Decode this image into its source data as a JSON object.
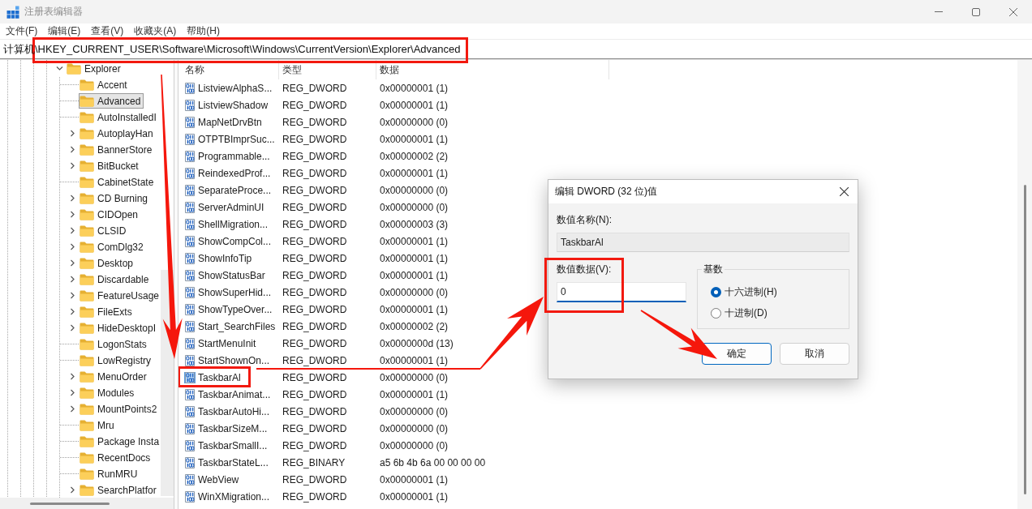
{
  "window": {
    "title": "注册表编辑器"
  },
  "menu": [
    "文件(F)",
    "编辑(E)",
    "查看(V)",
    "收藏夹(A)",
    "帮助(H)"
  ],
  "address_bar": {
    "path": "计算机\\HKEY_CURRENT_USER\\Software\\Microsoft\\Windows\\CurrentVersion\\Explorer\\Advanced",
    "highlighted": true
  },
  "tree": {
    "items": [
      {
        "label": "Explorer",
        "expandable": true,
        "expanded": true,
        "selected": false,
        "children": [
          {
            "label": "Accent",
            "expandable": false,
            "selected": false
          },
          {
            "label": "Advanced",
            "expandable": false,
            "selected": true
          },
          {
            "label": "AutoInstalledI",
            "expandable": false,
            "selected": false
          },
          {
            "label": "AutoplayHan",
            "expandable": true,
            "selected": false
          },
          {
            "label": "BannerStore",
            "expandable": true,
            "selected": false
          },
          {
            "label": "BitBucket",
            "expandable": true,
            "selected": false
          },
          {
            "label": "CabinetState",
            "expandable": false,
            "selected": false
          },
          {
            "label": "CD Burning",
            "expandable": true,
            "selected": false
          },
          {
            "label": "CIDOpen",
            "expandable": true,
            "selected": false
          },
          {
            "label": "CLSID",
            "expandable": true,
            "selected": false
          },
          {
            "label": "ComDlg32",
            "expandable": true,
            "selected": false
          },
          {
            "label": "Desktop",
            "expandable": true,
            "selected": false
          },
          {
            "label": "Discardable",
            "expandable": true,
            "selected": false
          },
          {
            "label": "FeatureUsage",
            "expandable": true,
            "selected": false
          },
          {
            "label": "FileExts",
            "expandable": true,
            "selected": false
          },
          {
            "label": "HideDesktopI",
            "expandable": true,
            "selected": false
          },
          {
            "label": "LogonStats",
            "expandable": false,
            "selected": false
          },
          {
            "label": "LowRegistry",
            "expandable": false,
            "selected": false
          },
          {
            "label": "MenuOrder",
            "expandable": true,
            "selected": false
          },
          {
            "label": "Modules",
            "expandable": true,
            "selected": false
          },
          {
            "label": "MountPoints2",
            "expandable": true,
            "selected": false
          },
          {
            "label": "Mru",
            "expandable": false,
            "selected": false
          },
          {
            "label": "Package Insta",
            "expandable": false,
            "selected": false
          },
          {
            "label": "RecentDocs",
            "expandable": false,
            "selected": false
          },
          {
            "label": "RunMRU",
            "expandable": false,
            "selected": false
          },
          {
            "label": "SearchPlatfor",
            "expandable": true,
            "selected": false
          }
        ]
      }
    ]
  },
  "values_table": {
    "columns": [
      "名称",
      "类型",
      "数据"
    ],
    "rows": [
      {
        "name": "ListviewAlphaS...",
        "type": "REG_DWORD",
        "data": "0x00000001 (1)",
        "selected": false,
        "highlighted": false
      },
      {
        "name": "ListviewShadow",
        "type": "REG_DWORD",
        "data": "0x00000001 (1)",
        "selected": false,
        "highlighted": false
      },
      {
        "name": "MapNetDrvBtn",
        "type": "REG_DWORD",
        "data": "0x00000000 (0)",
        "selected": false,
        "highlighted": false
      },
      {
        "name": "OTPTBImprSuc...",
        "type": "REG_DWORD",
        "data": "0x00000001 (1)",
        "selected": false,
        "highlighted": false
      },
      {
        "name": "Programmable...",
        "type": "REG_DWORD",
        "data": "0x00000002 (2)",
        "selected": false,
        "highlighted": false
      },
      {
        "name": "ReindexedProf...",
        "type": "REG_DWORD",
        "data": "0x00000001 (1)",
        "selected": false,
        "highlighted": false
      },
      {
        "name": "SeparateProce...",
        "type": "REG_DWORD",
        "data": "0x00000000 (0)",
        "selected": false,
        "highlighted": false
      },
      {
        "name": "ServerAdminUI",
        "type": "REG_DWORD",
        "data": "0x00000000 (0)",
        "selected": false,
        "highlighted": false
      },
      {
        "name": "ShellMigration...",
        "type": "REG_DWORD",
        "data": "0x00000003 (3)",
        "selected": false,
        "highlighted": false
      },
      {
        "name": "ShowCompCol...",
        "type": "REG_DWORD",
        "data": "0x00000001 (1)",
        "selected": false,
        "highlighted": false
      },
      {
        "name": "ShowInfoTip",
        "type": "REG_DWORD",
        "data": "0x00000001 (1)",
        "selected": false,
        "highlighted": false
      },
      {
        "name": "ShowStatusBar",
        "type": "REG_DWORD",
        "data": "0x00000001 (1)",
        "selected": false,
        "highlighted": false
      },
      {
        "name": "ShowSuperHid...",
        "type": "REG_DWORD",
        "data": "0x00000000 (0)",
        "selected": false,
        "highlighted": false
      },
      {
        "name": "ShowTypeOver...",
        "type": "REG_DWORD",
        "data": "0x00000001 (1)",
        "selected": false,
        "highlighted": false
      },
      {
        "name": "Start_SearchFiles",
        "type": "REG_DWORD",
        "data": "0x00000002 (2)",
        "selected": false,
        "highlighted": false
      },
      {
        "name": "StartMenuInit",
        "type": "REG_DWORD",
        "data": "0x0000000d (13)",
        "selected": false,
        "highlighted": false
      },
      {
        "name": "StartShownOn...",
        "type": "REG_DWORD",
        "data": "0x00000001 (1)",
        "selected": false,
        "highlighted": false
      },
      {
        "name": "TaskbarAl",
        "type": "REG_DWORD",
        "data": "0x00000000 (0)",
        "selected": true,
        "highlighted": true
      },
      {
        "name": "TaskbarAnimat...",
        "type": "REG_DWORD",
        "data": "0x00000001 (1)",
        "selected": false,
        "highlighted": false
      },
      {
        "name": "TaskbarAutoHi...",
        "type": "REG_DWORD",
        "data": "0x00000000 (0)",
        "selected": false,
        "highlighted": false
      },
      {
        "name": "TaskbarSizeM...",
        "type": "REG_DWORD",
        "data": "0x00000000 (0)",
        "selected": false,
        "highlighted": false
      },
      {
        "name": "TaskbarSmallI...",
        "type": "REG_DWORD",
        "data": "0x00000000 (0)",
        "selected": false,
        "highlighted": false
      },
      {
        "name": "TaskbarStateL...",
        "type": "REG_BINARY",
        "data": "a5 6b 4b 6a 00 00 00 00",
        "selected": false,
        "highlighted": false
      },
      {
        "name": "WebView",
        "type": "REG_DWORD",
        "data": "0x00000001 (1)",
        "selected": false,
        "highlighted": false
      },
      {
        "name": "WinXMigration...",
        "type": "REG_DWORD",
        "data": "0x00000001 (1)",
        "selected": false,
        "highlighted": false
      }
    ]
  },
  "dialog": {
    "title": "编辑 DWORD (32 位)值",
    "name_field": {
      "label": "数值名称(N):",
      "value": "TaskbarAl",
      "disabled": true
    },
    "data_field": {
      "label": "数值数据(V):",
      "value": "0",
      "highlighted": true
    },
    "base": {
      "title": "基数",
      "options": [
        {
          "label": "十六进制(H)",
          "selected": true
        },
        {
          "label": "十进制(D)",
          "selected": false
        }
      ]
    },
    "buttons": [
      {
        "label": "确定",
        "default": true
      },
      {
        "label": "取消",
        "default": false
      }
    ]
  }
}
